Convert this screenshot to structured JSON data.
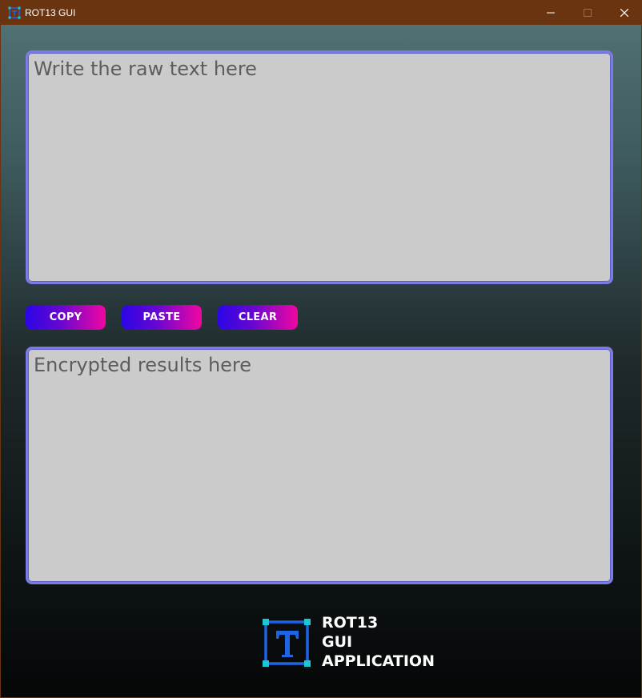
{
  "window": {
    "title": "ROT13 GUI",
    "icon": "rot13-app-icon",
    "controls": {
      "minimize": "minimize-icon",
      "maximize": "maximize-icon",
      "close": "close-icon"
    }
  },
  "input": {
    "placeholder": "Write the raw text here",
    "value": ""
  },
  "buttons": {
    "copy_label": "COPY",
    "paste_label": "PASTE",
    "clear_label": "CLEAR"
  },
  "output": {
    "placeholder": "Encrypted results here",
    "value": ""
  },
  "logo": {
    "icon": "text-tool-logo-icon",
    "lines": [
      "ROT13",
      "GUI",
      "APPLICATION"
    ]
  },
  "colors": {
    "titlebar": "#6b3410",
    "textbox_background": "#cbcbcb",
    "textbox_border": "#7b7be6",
    "button_gradient_start": "#2b06e6",
    "button_gradient_end": "#f206a0",
    "logo_blue": "#1e64e6",
    "logo_cyan": "#18c8d2"
  }
}
